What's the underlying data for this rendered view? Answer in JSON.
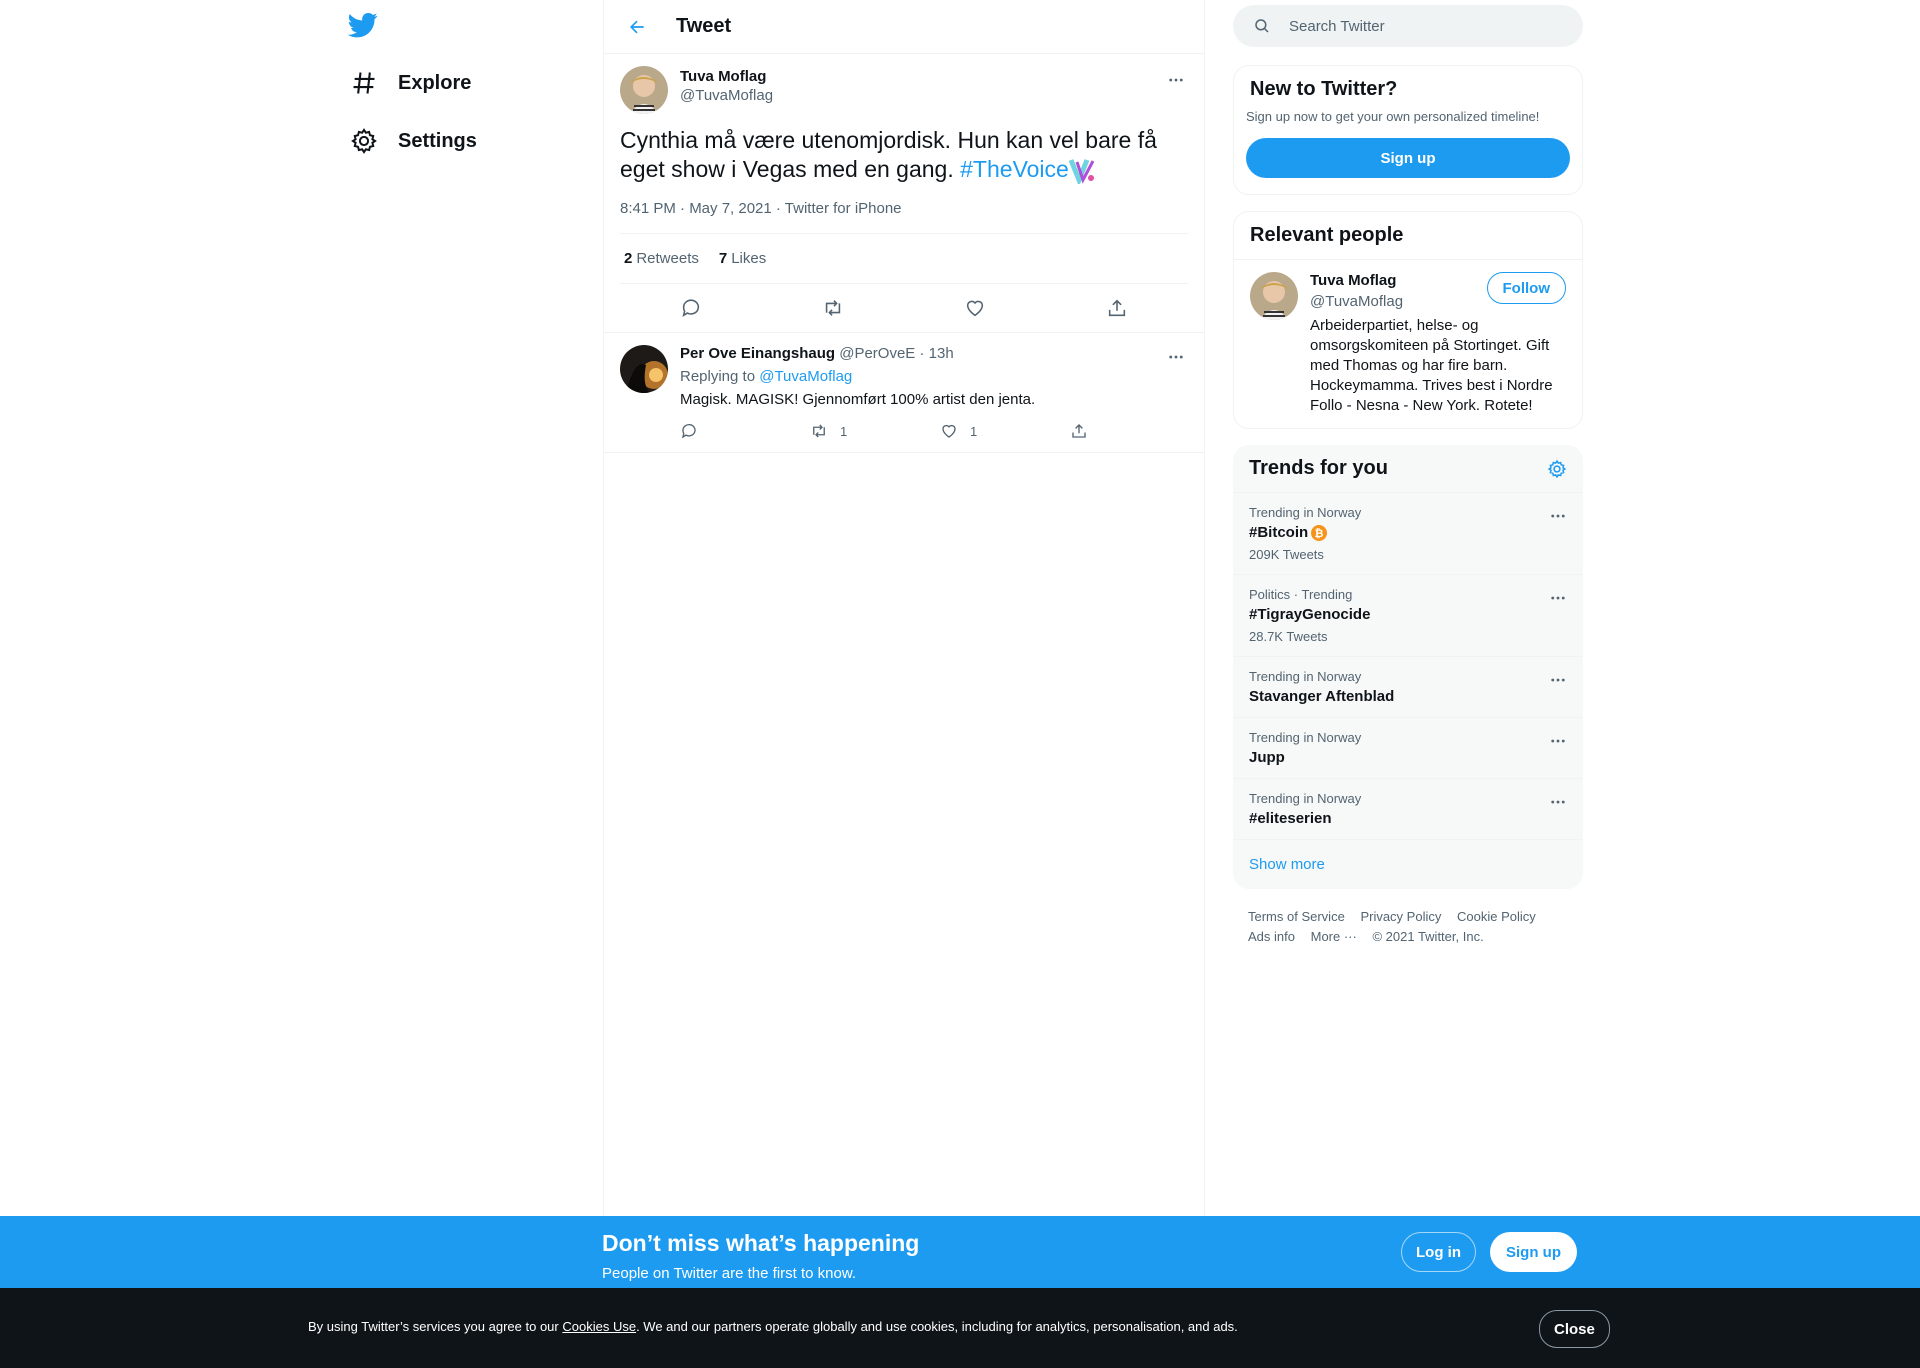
{
  "nav": {
    "items": [
      {
        "label": "Explore",
        "icon": "hashtag-icon"
      },
      {
        "label": "Settings",
        "icon": "gear-icon"
      }
    ]
  },
  "header": {
    "title": "Tweet"
  },
  "tweet": {
    "name": "Tuva Moflag",
    "handle": "@TuvaMoflag",
    "text": "Cynthia må være utenomjordisk. Hun kan vel bare få eget show i Vegas med en gang. ",
    "hashtag": "#TheVoice",
    "meta": "8:41 PM · May 7, 2021 · Twitter for iPhone",
    "retweets_count": "2",
    "retweets_label": "Retweets",
    "likes_count": "7",
    "likes_label": "Likes"
  },
  "reply": {
    "name": "Per Ove Einangshaug",
    "handle_time": "@PerOveE · 13h",
    "replying_prefix": "Replying to ",
    "replying_to": "@TuvaMoflag",
    "text": "Magisk. MAGISK! Gjennomført 100% artist den jenta.",
    "retweets": "1",
    "likes": "1"
  },
  "search": {
    "placeholder": "Search Twitter"
  },
  "new_to_twitter": {
    "title": "New to Twitter?",
    "subtitle": "Sign up now to get your own personalized timeline!",
    "button": "Sign up"
  },
  "relevant_people": {
    "title": "Relevant people",
    "name": "Tuva Moflag",
    "handle": "@TuvaMoflag",
    "follow": "Follow",
    "bio": "Arbeiderpartiet, helse- og omsorgskomiteen på Stortinget. Gift med Thomas og har fire barn. Hockeymamma. Trives best i Nordre Follo - Nesna - New York. Rotete!"
  },
  "trends": {
    "title": "Trends for you",
    "items": [
      {
        "context": "Trending in Norway",
        "name": "#Bitcoin",
        "count": "209K Tweets"
      },
      {
        "context": "Politics · Trending",
        "name": "#TigrayGenocide",
        "count": "28.7K Tweets"
      },
      {
        "context": "Trending in Norway",
        "name": "Stavanger Aftenblad",
        "count": ""
      },
      {
        "context": "Trending in Norway",
        "name": "Jupp",
        "count": ""
      },
      {
        "context": "Trending in Norway",
        "name": "#eliteserien",
        "count": ""
      }
    ],
    "show_more": "Show more"
  },
  "footer": {
    "links": [
      "Terms of Service",
      "Privacy Policy",
      "Cookie Policy",
      "Ads info",
      "More ···",
      "© 2021 Twitter, Inc."
    ]
  },
  "bottom_bar": {
    "title": "Don’t miss what’s happening",
    "subtitle": "People on Twitter are the first to know.",
    "login": "Log in",
    "signup": "Sign up"
  },
  "cookie_bar": {
    "prefix": "By using Twitter’s services you agree to our ",
    "link": "Cookies Use",
    "suffix": ". We and our partners operate globally and use cookies, including for analytics, personalisation, and ads.",
    "close": "Close"
  },
  "colors": {
    "accent": "#1d9bf0",
    "text": "#0f1419",
    "muted": "#536471",
    "dark": "#0f1419"
  }
}
